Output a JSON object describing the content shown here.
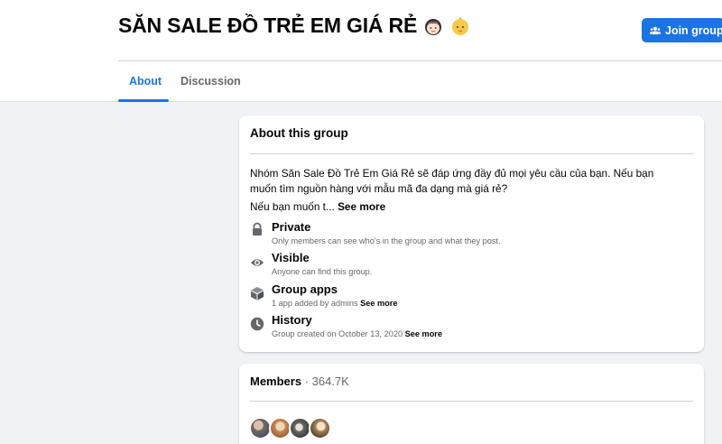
{
  "header": {
    "title": "SĂN SALE ĐỒ TRẺ EM GIÁ RẺ",
    "join_label": "Join group"
  },
  "tabs": [
    {
      "label": "About",
      "active": true
    },
    {
      "label": "Discussion",
      "active": false
    }
  ],
  "about": {
    "heading": "About this group",
    "description": "Nhóm Săn Sale Đồ Trẻ Em Giá Rẻ sẽ đáp ứng đầy đủ mọi yêu cầu của bạn. Nếu bạn muốn tìm nguồn hàng với mẫu mã đa dạng mà giá rẻ?",
    "description_truncated": "Nếu bạn muốn t...",
    "see_more": "See more",
    "rows": [
      {
        "icon": "lock-icon",
        "title": "Private",
        "subtitle": "Only members can see who's in the group and what they post.",
        "link": ""
      },
      {
        "icon": "eye-icon",
        "title": "Visible",
        "subtitle": "Anyone can find this group.",
        "link": ""
      },
      {
        "icon": "cube-icon",
        "title": "Group apps",
        "subtitle": "1 app added by admins",
        "link": "See more"
      },
      {
        "icon": "clock-icon",
        "title": "History",
        "subtitle": "Group created on October 13, 2020",
        "link": "See more"
      }
    ]
  },
  "members": {
    "label": "Members",
    "count": "· 364.7K"
  },
  "colors": {
    "accent": "#1b74e4",
    "background": "#f0f2f5",
    "secondary_text": "#65676b"
  }
}
